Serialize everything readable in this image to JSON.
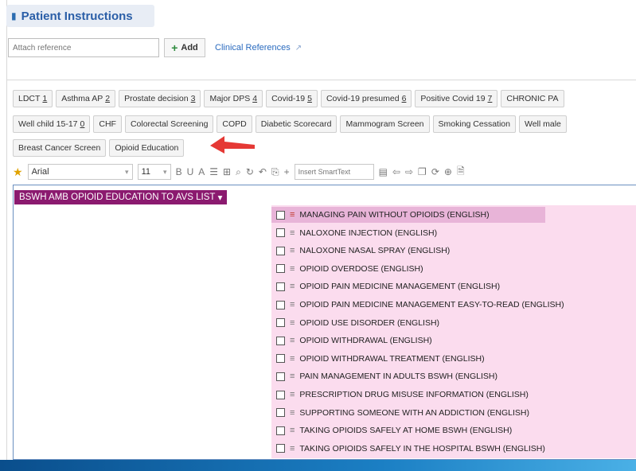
{
  "header": {
    "title": "Patient Instructions"
  },
  "attach": {
    "placeholder": "Attach reference",
    "add_label": "Add",
    "clinical_references": "Clinical References"
  },
  "chips": {
    "row1": [
      {
        "label": "LDCT",
        "num": "1"
      },
      {
        "label": "Asthma AP",
        "num": "2"
      },
      {
        "label": "Prostate decision",
        "num": "3"
      },
      {
        "label": "Major DPS",
        "num": "4"
      },
      {
        "label": "Covid-19",
        "num": "5"
      },
      {
        "label": "Covid-19 presumed",
        "num": "6"
      },
      {
        "label": "Positive Covid 19",
        "num": "7"
      },
      {
        "label": "CHRONIC PA",
        "num": ""
      }
    ],
    "row2": [
      {
        "label": "Well child 15-17",
        "num": "0"
      },
      {
        "label": "CHF",
        "num": ""
      },
      {
        "label": "Colorectal Screening",
        "num": ""
      },
      {
        "label": "COPD",
        "num": ""
      },
      {
        "label": "Diabetic Scorecard",
        "num": ""
      },
      {
        "label": "Mammogram Screen",
        "num": ""
      },
      {
        "label": "Smoking Cessation",
        "num": ""
      },
      {
        "label": "Well male",
        "num": ""
      }
    ],
    "row3": [
      {
        "label": "Breast Cancer Screen",
        "num": ""
      },
      {
        "label": "Opioid Education",
        "num": ""
      }
    ]
  },
  "toolbar": {
    "font": "Arial",
    "size": "11",
    "smarttext_placeholder": "Insert SmartText"
  },
  "smartlist": {
    "title": "BSWH AMB OPIOID EDUCATION TO AVS LIST",
    "items": [
      "MANAGING PAIN WITHOUT OPIOIDS (ENGLISH)",
      "NALOXONE INJECTION (ENGLISH)",
      "NALOXONE NASAL SPRAY (ENGLISH)",
      "OPIOID OVERDOSE (ENGLISH)",
      "OPIOID PAIN MEDICINE MANAGEMENT (ENGLISH)",
      "OPIOID PAIN MEDICINE MANAGEMENT  EASY-TO-READ (ENGLISH)",
      "OPIOID USE DISORDER (ENGLISH)",
      "OPIOID WITHDRAWAL (ENGLISH)",
      "OPIOID WITHDRAWAL TREATMENT (ENGLISH)",
      "PAIN MANAGEMENT IN ADULTS BSWH (ENGLISH)",
      "PRESCRIPTION DRUG MISUSE INFORMATION (ENGLISH)",
      "SUPPORTING SOMEONE WITH AN ADDICTION (ENGLISH)",
      "TAKING OPIOIDS SAFELY AT HOME BSWH (ENGLISH)",
      "TAKING OPIOIDS SAFELY IN THE HOSPITAL BSWH (ENGLISH)"
    ]
  },
  "colors": {
    "accent": "#2a5ea7",
    "smartlist_tag": "#8b1a6f",
    "panel": "#fbdcee",
    "arrow": "#e53935"
  }
}
